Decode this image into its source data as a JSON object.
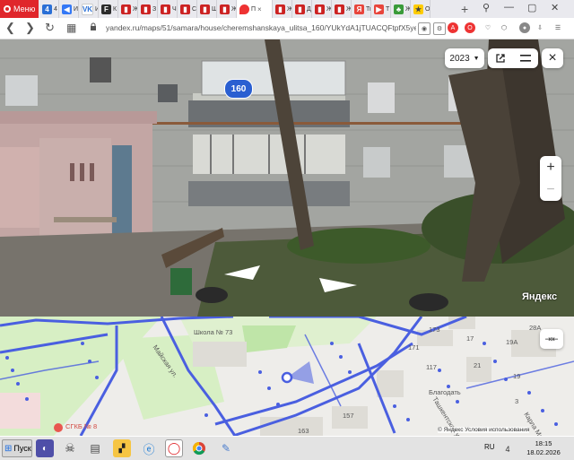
{
  "browser": {
    "menu_label": "Меню",
    "tabs": [
      {
        "label": "4",
        "color": "#2a6fd6",
        "glyph": "4"
      },
      {
        "label": "И",
        "color": "#3478f6",
        "glyph": "◀"
      },
      {
        "label": "И",
        "color": "#ffffff",
        "glyph": "VK"
      },
      {
        "label": "К",
        "color": "#2b2b2b",
        "glyph": "F"
      },
      {
        "label": "Ж",
        "color": "#cc2222",
        "glyph": "▮"
      },
      {
        "label": "З",
        "color": "#cc2222",
        "glyph": "▮"
      },
      {
        "label": "Ч",
        "color": "#cc2222",
        "glyph": "▮"
      },
      {
        "label": "С",
        "color": "#cc2222",
        "glyph": "▮"
      },
      {
        "label": "Ш",
        "color": "#cc2222",
        "glyph": "▮"
      },
      {
        "label": "Ж",
        "color": "#cc2222",
        "glyph": "▮"
      }
    ],
    "active_tab": {
      "label": "П",
      "close": "×"
    },
    "tabs_after": [
      {
        "label": "Ж",
        "color": "#cc2222",
        "glyph": "▮"
      },
      {
        "label": "Д",
        "color": "#cc2222",
        "glyph": "▮"
      },
      {
        "label": "Ж",
        "color": "#cc2222",
        "glyph": "▮"
      },
      {
        "label": "Ж",
        "color": "#cc2222",
        "glyph": "▮"
      },
      {
        "label": "Ти",
        "color": "#e8453c",
        "glyph": "Я"
      },
      {
        "label": "Т",
        "color": "#e8453c",
        "glyph": "▶"
      },
      {
        "label": "Ж",
        "color": "#3a9b3a",
        "glyph": "♣"
      },
      {
        "label": "О",
        "color": "#ffcc00",
        "glyph": "★"
      }
    ],
    "add_tab": "+",
    "url": "yandex.ru/maps/51/samara/house/cheremshanskaya_ulitsa_160/YUkYdA1jTUACQFtpfX5yeX9hYA"
  },
  "panorama": {
    "year": "2023",
    "house_number": "160",
    "logo": "Яндекс",
    "zoom_in": "+",
    "zoom_out": "−",
    "close": "×"
  },
  "minimap": {
    "labels": {
      "school": "Школа № 73",
      "street1": "Майская ул.",
      "street2": "Ташкентская ул.",
      "street3": "Карла Маркса",
      "hospital": "СГКБ № 8",
      "church": "Благодать",
      "n171": "171",
      "n173": "173",
      "n117": "117",
      "n157": "157",
      "n163": "163",
      "n19a": "19А",
      "n28a": "28А",
      "n17": "17",
      "n21": "21",
      "n19": "19",
      "n3": "3"
    },
    "attribution": "© Яндекс   Условия использования"
  },
  "taskbar": {
    "start_label": "Пуск",
    "lang": "RU",
    "time": "18:15",
    "date": "18.02.2026"
  }
}
